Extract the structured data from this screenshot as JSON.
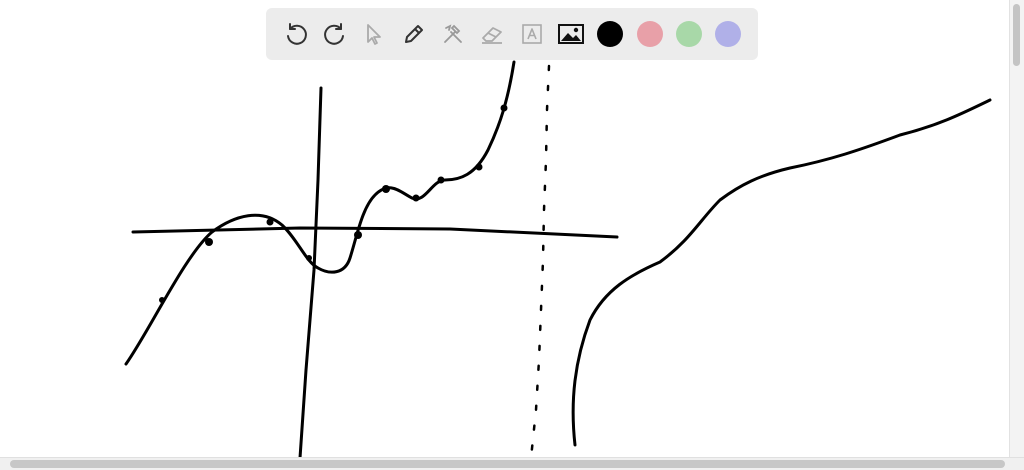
{
  "toolbar": {
    "tools": [
      {
        "name": "undo-icon"
      },
      {
        "name": "redo-icon"
      },
      {
        "name": "pointer-icon",
        "disabled": true
      },
      {
        "name": "pen-icon"
      },
      {
        "name": "tools-icon",
        "disabled": true
      },
      {
        "name": "eraser-icon",
        "disabled": true
      },
      {
        "name": "text-icon",
        "disabled": true
      },
      {
        "name": "image-icon"
      }
    ],
    "colors": [
      "#000000",
      "#e8a0a8",
      "#a8d8a8",
      "#b0b0e8"
    ]
  }
}
